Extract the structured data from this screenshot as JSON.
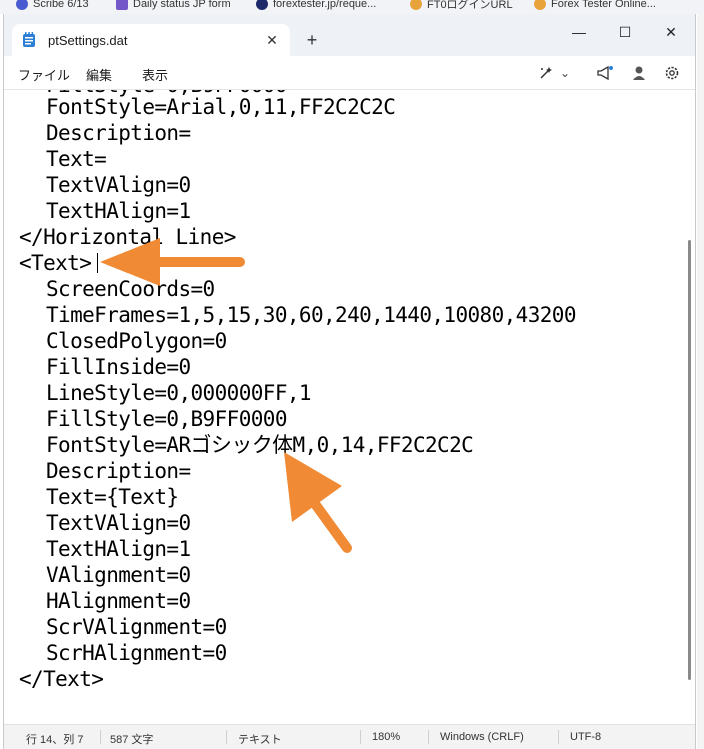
{
  "bookmarks": [
    {
      "label": "Scribe 6/13",
      "color": "#4a5bd1"
    },
    {
      "label": "Daily status JP form",
      "color": "#7357c9"
    },
    {
      "label": "forextester.jp/reque...",
      "color": "#1c2a6a"
    },
    {
      "label": "FT0ログインURL",
      "color": "#e8a33b"
    },
    {
      "label": "Forex Tester Online...",
      "color": "#e8a33b"
    }
  ],
  "window": {
    "tab_title": "ptSettings.dat",
    "tab_close": "✕",
    "new_tab": "+",
    "minimize": "—",
    "maximize": "☐",
    "close": "✕"
  },
  "menu": {
    "file": "ファイル",
    "edit": "編集",
    "view": "表示"
  },
  "toolbar": {
    "copilot_chevron": "⌄"
  },
  "editor": {
    "lines": [
      "FontStyle=Arial,0,11,FF2C2C2C",
      "Description=",
      "Text=",
      "TextVAlign=0",
      "TextHAlign=1",
      "</Horizontal Line>",
      "<Text>",
      "ScreenCoords=0",
      "TimeFrames=1,5,15,30,60,240,1440,10080,43200",
      "ClosedPolygon=0",
      "FillInside=0",
      "LineStyle=0,000000FF,1",
      "FillStyle=0,B9FF0000",
      "FontStyle=ARゴシック体M,0,14,FF2C2C2C",
      "Description=",
      "Text={Text}",
      "TextVAlign=0",
      "TextHAlign=1",
      "VAlignment=0",
      "HAlignment=0",
      "ScrVAlignment=0",
      "ScrHAlignment=0",
      "</Text>"
    ]
  },
  "status": {
    "position": "行 14、列 7",
    "chars": "587 文字",
    "format": "テキスト",
    "zoom": "180%",
    "line_ending": "Windows (CRLF)",
    "encoding": "UTF-8"
  },
  "colors": {
    "arrow": "#f08a34",
    "titlebar": "#eef1f5"
  },
  "icons": [
    "notepad-icon",
    "copilot-icon",
    "megaphone-icon",
    "account-icon",
    "settings-gear-icon"
  ]
}
